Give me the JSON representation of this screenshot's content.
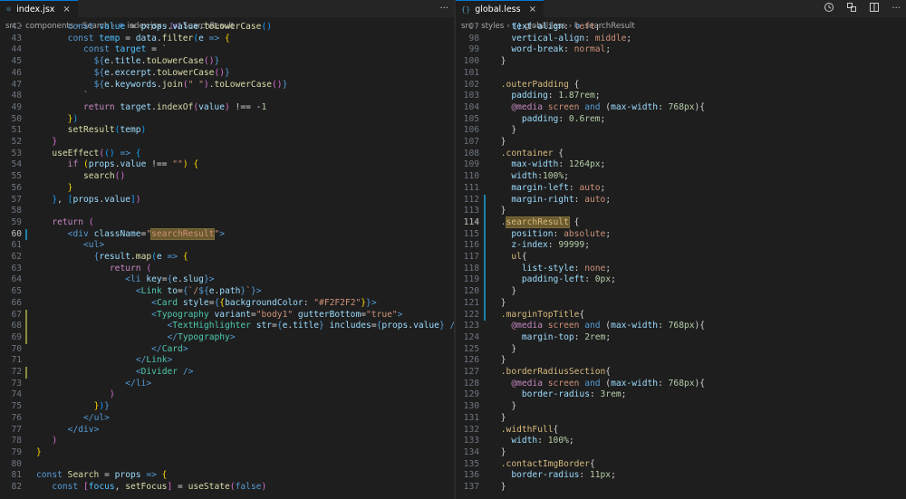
{
  "left": {
    "tab": {
      "icon": "react-file-icon",
      "label": "index.jsx",
      "close": "×"
    },
    "actions": "···",
    "breadcrumb": [
      "src",
      "components",
      "Search",
      "index.jsx",
      "SearchResult"
    ],
    "active_line": 60,
    "lines": [
      {
        "n": "42",
        "html": "<span class='b'>const</span> <span class='c'>value</span> = <span class='v'>props</span>.<span class='v'>value</span>.<span class='f'>toLowerCase</span><span class='br3'>()</span>",
        "indent": 6
      },
      {
        "n": "43",
        "html": "<span class='b'>const</span> <span class='c'>temp</span> = <span class='v'>data</span>.<span class='f'>filter</span><span class='br3'>(</span><span class='v'>e</span> <span class='b'>=&gt;</span> <span class='br1'>{</span>",
        "indent": 6
      },
      {
        "n": "44",
        "html": "<span class='b'>const</span> <span class='c'>target</span> = <span class='s'>`</span>",
        "indent": 9
      },
      {
        "n": "45",
        "html": "<span class='b'>${</span><span class='v'>e</span>.<span class='v'>title</span>.<span class='f'>toLowerCase</span><span class='br2'>()</span><span class='b'>}</span>",
        "indent": 11
      },
      {
        "n": "46",
        "html": "<span class='b'>${</span><span class='v'>e</span>.<span class='v'>excerpt</span>.<span class='f'>toLowerCase</span><span class='br2'>()</span><span class='b'>}</span>",
        "indent": 11
      },
      {
        "n": "47",
        "html": "<span class='b'>${</span><span class='v'>e</span>.<span class='v'>keywords</span>.<span class='f'>join</span><span class='br2'>(</span><span class='s'>\" \"</span><span class='br2'>)</span>.<span class='f'>toLowerCase</span><span class='br2'>()</span><span class='b'>}</span>",
        "indent": 11
      },
      {
        "n": "48",
        "html": "<span class='s'>`</span>",
        "indent": 9
      },
      {
        "n": "49",
        "html": "<span class='k'>return</span> <span class='v'>target</span>.<span class='f'>indexOf</span><span class='br2'>(</span><span class='v'>value</span><span class='br2'>)</span> !== -<span class='n'>1</span>",
        "indent": 9
      },
      {
        "n": "50",
        "html": "<span class='br1'>}</span><span class='br3'>)</span>",
        "indent": 6
      },
      {
        "n": "51",
        "html": "<span class='f'>setResult</span><span class='br3'>(</span><span class='v'>temp</span><span class='br3'>)</span>",
        "indent": 6
      },
      {
        "n": "52",
        "html": "<span class='br2'>}</span>",
        "indent": 3
      },
      {
        "n": "53",
        "html": "<span class='f'>useEffect</span><span class='br2'>(</span><span class='br3'>()</span> <span class='b'>=&gt;</span> <span class='br3'>{</span>",
        "indent": 3
      },
      {
        "n": "54",
        "html": "<span class='k'>if</span> <span class='br1'>(</span><span class='v'>props</span>.<span class='v'>value</span> !== <span class='s'>\"\"</span><span class='br1'>)</span> <span class='br1'>{</span>",
        "indent": 6
      },
      {
        "n": "55",
        "html": "<span class='f'>search</span><span class='br2'>()</span>",
        "indent": 9
      },
      {
        "n": "56",
        "html": "<span class='br1'>}</span>",
        "indent": 6
      },
      {
        "n": "57",
        "html": "<span class='br3'>}</span>, <span class='br3'>[</span><span class='v'>props</span>.<span class='v'>value</span><span class='br3'>]</span><span class='br2'>)</span>",
        "indent": 3
      },
      {
        "n": "58",
        "html": "",
        "indent": 0
      },
      {
        "n": "59",
        "html": "<span class='k'>return</span> <span class='br2'>(</span>",
        "indent": 3
      },
      {
        "n": "60",
        "html": "<span class='b'>&lt;</span><span class='b'>div</span> <span class='v'>className</span>=<span class='s'>\"<span class='hl'>searchResult</span>\"</span><span class='b'>&gt;</span>",
        "indent": 6
      },
      {
        "n": "61",
        "html": "<span class='b'>&lt;</span><span class='b'>ul</span><span class='b'>&gt;</span>",
        "indent": 9
      },
      {
        "n": "62",
        "html": "<span class='b'>{</span><span class='v'>result</span>.<span class='f'>map</span><span class='br3'>(</span><span class='v'>e</span> <span class='b'>=&gt;</span> <span class='br1'>{</span>",
        "indent": 11
      },
      {
        "n": "63",
        "html": "<span class='k'>return</span> <span class='br2'>(</span>",
        "indent": 14
      },
      {
        "n": "64",
        "html": "<span class='b'>&lt;</span><span class='b'>li</span> <span class='v'>key</span>=<span class='b'>{</span><span class='v'>e</span>.<span class='v'>slug</span><span class='b'>}</span><span class='b'>&gt;</span>",
        "indent": 17
      },
      {
        "n": "65",
        "html": "<span class='b'>&lt;</span><span class='t'>Link</span> <span class='v'>to</span>=<span class='b'>{</span><span class='s'>`/</span><span class='b'>${</span><span class='v'>e</span>.<span class='v'>path</span><span class='b'>}</span><span class='s'>`</span><span class='b'>}</span><span class='b'>&gt;</span>",
        "indent": 19
      },
      {
        "n": "66",
        "html": "<span class='b'>&lt;</span><span class='t'>Card</span> <span class='v'>style</span>=<span class='b'>{</span><span class='br1'>{</span><span class='v'>backgroundColor</span>: <span class='s'>\"#F2F2F2\"</span><span class='br1'>}</span><span class='b'>}</span><span class='b'>&gt;</span>",
        "indent": 22
      },
      {
        "n": "67",
        "html": "<span class='b'>&lt;</span><span class='t'>Typography</span> <span class='v'>variant</span>=<span class='s'>\"body1\"</span> <span class='v'>gutterBottom</span>=<span class='s'>\"true\"</span><span class='b'>&gt;</span>",
        "indent": 22
      },
      {
        "n": "68",
        "html": "<span class='b'>&lt;</span><span class='t'>TextHighlighter</span> <span class='v'>str</span>=<span class='b'>{</span><span class='v'>e</span>.<span class='v'>title</span><span class='b'>}</span> <span class='v'>includes</span>=<span class='b'>{</span><span class='v'>props</span>.<span class='v'>value</span><span class='b'>}</span> <span class='b'>/&gt;</span>",
        "indent": 25
      },
      {
        "n": "69",
        "html": "<span class='b'>&lt;/</span><span class='t'>Typography</span><span class='b'>&gt;</span>",
        "indent": 25
      },
      {
        "n": "70",
        "html": "<span class='b'>&lt;/</span><span class='t'>Card</span><span class='b'>&gt;</span>",
        "indent": 22
      },
      {
        "n": "71",
        "html": "<span class='b'>&lt;/</span><span class='t'>Link</span><span class='b'>&gt;</span>",
        "indent": 19
      },
      {
        "n": "72",
        "html": "<span class='b'>&lt;</span><span class='t'>Divider</span> <span class='b'>/&gt;</span>",
        "indent": 19
      },
      {
        "n": "73",
        "html": "<span class='b'>&lt;/</span><span class='b'>li</span><span class='b'>&gt;</span>",
        "indent": 17
      },
      {
        "n": "74",
        "html": "<span class='br2'>)</span>",
        "indent": 14
      },
      {
        "n": "75",
        "html": "<span class='br1'>}</span><span class='br3'>)</span><span class='b'>}</span>",
        "indent": 11
      },
      {
        "n": "76",
        "html": "<span class='b'>&lt;/</span><span class='b'>ul</span><span class='b'>&gt;</span>",
        "indent": 9
      },
      {
        "n": "77",
        "html": "<span class='b'>&lt;/</span><span class='b'>div</span><span class='b'>&gt;</span>",
        "indent": 6
      },
      {
        "n": "78",
        "html": "<span class='br2'>)</span>",
        "indent": 3
      },
      {
        "n": "79",
        "html": "<span class='br1'>}</span>",
        "indent": 0
      },
      {
        "n": "80",
        "html": "",
        "indent": 0
      },
      {
        "n": "81",
        "html": "<span class='b'>const</span> <span class='f'>Search</span> = <span class='v'>props</span> <span class='b'>=&gt;</span> <span class='br1'>{</span>",
        "indent": 0
      },
      {
        "n": "82",
        "html": "<span class='b'>const</span> <span class='br2'>[</span><span class='c'>focus</span>, <span class='f'>setFocus</span><span class='br2'>]</span> = <span class='f'>useState</span><span class='br2'>(</span><span class='b'>false</span><span class='br2'>)</span>",
        "indent": 3
      }
    ]
  },
  "right": {
    "tab": {
      "icon": "braces-icon",
      "label": "global.less",
      "close": "×"
    },
    "breadcrumb": [
      "src",
      "styles",
      "global.less",
      ".searchResult"
    ],
    "active_line": 114,
    "lines": [
      {
        "n": "97",
        "html": "<span class='pr'>text-align</span>: <span class='val'>left</span>;",
        "indent": 3
      },
      {
        "n": "98",
        "html": "<span class='pr'>vertical-align</span>: <span class='val'>middle</span>;",
        "indent": 3
      },
      {
        "n": "99",
        "html": "<span class='pr'>word-break</span>: <span class='val'>normal</span>;",
        "indent": 3
      },
      {
        "n": "100",
        "html": "}",
        "indent": 1
      },
      {
        "n": "101",
        "html": "",
        "indent": 0
      },
      {
        "n": "102",
        "html": "<span class='sel'>.outerPadding</span> {",
        "indent": 1
      },
      {
        "n": "103",
        "html": "<span class='pr'>padding</span>: <span class='num'>1.87rem</span>;",
        "indent": 3
      },
      {
        "n": "104",
        "html": "<span class='k'>@media</span> <span class='val'>screen</span> <span class='b'>and</span> (<span class='pr'>max-width</span>: <span class='num'>768px</span>){",
        "indent": 3
      },
      {
        "n": "105",
        "html": "<span class='pr'>padding</span>: <span class='num'>0.6rem</span>;",
        "indent": 5
      },
      {
        "n": "106",
        "html": "}",
        "indent": 3
      },
      {
        "n": "107",
        "html": "}",
        "indent": 1
      },
      {
        "n": "108",
        "html": "<span class='sel'>.container</span> {",
        "indent": 1
      },
      {
        "n": "109",
        "html": "<span class='pr'>max-width</span>: <span class='num'>1264px</span>;",
        "indent": 3
      },
      {
        "n": "110",
        "html": "<span class='pr'>width</span>:<span class='num'>100%</span>;",
        "indent": 3
      },
      {
        "n": "111",
        "html": "<span class='pr'>margin-left</span>: <span class='val'>auto</span>;",
        "indent": 3
      },
      {
        "n": "112",
        "html": "<span class='pr'>margin-right</span>: <span class='val'>auto</span>;",
        "indent": 3
      },
      {
        "n": "113",
        "html": "}",
        "indent": 1
      },
      {
        "n": "114",
        "html": "<span class='sel'>.<span class='hl'>searchResult</span></span> {",
        "indent": 1
      },
      {
        "n": "115",
        "html": "<span class='pr'>position</span>: <span class='val'>absolute</span>;",
        "indent": 3
      },
      {
        "n": "116",
        "html": "<span class='pr'>z-index</span>: <span class='num'>99999</span>;",
        "indent": 3
      },
      {
        "n": "117",
        "html": "<span class='sel'>ul</span>{",
        "indent": 3
      },
      {
        "n": "118",
        "html": "<span class='pr'>list-style</span>: <span class='val'>none</span>;",
        "indent": 5
      },
      {
        "n": "119",
        "html": "<span class='pr'>padding-left</span>: <span class='num'>0px</span>;",
        "indent": 5
      },
      {
        "n": "120",
        "html": "}",
        "indent": 3
      },
      {
        "n": "121",
        "html": "}",
        "indent": 1
      },
      {
        "n": "122",
        "html": "<span class='sel'>.marginTopTitle</span>{",
        "indent": 1
      },
      {
        "n": "123",
        "html": "<span class='k'>@media</span> <span class='val'>screen</span> <span class='b'>and</span> (<span class='pr'>max-width</span>: <span class='num'>768px</span>){",
        "indent": 3
      },
      {
        "n": "124",
        "html": "<span class='pr'>margin-top</span>: <span class='num'>2rem</span>;",
        "indent": 5
      },
      {
        "n": "125",
        "html": "}",
        "indent": 3
      },
      {
        "n": "126",
        "html": "}",
        "indent": 1
      },
      {
        "n": "127",
        "html": "<span class='sel'>.borderRadiusSection</span>{",
        "indent": 1
      },
      {
        "n": "128",
        "html": "<span class='k'>@media</span> <span class='val'>screen</span> <span class='b'>and</span> (<span class='pr'>max-width</span>: <span class='num'>768px</span>){",
        "indent": 3
      },
      {
        "n": "129",
        "html": "<span class='pr'>border-radius</span>: <span class='num'>3rem</span>;",
        "indent": 5
      },
      {
        "n": "130",
        "html": "}",
        "indent": 3
      },
      {
        "n": "131",
        "html": "}",
        "indent": 1
      },
      {
        "n": "132",
        "html": "<span class='sel'>.widthFull</span>{",
        "indent": 1
      },
      {
        "n": "133",
        "html": "<span class='pr'>width</span>: <span class='num'>100%</span>;",
        "indent": 3
      },
      {
        "n": "134",
        "html": "}",
        "indent": 1
      },
      {
        "n": "135",
        "html": "<span class='sel'>.contactImgBorder</span>{",
        "indent": 1
      },
      {
        "n": "136",
        "html": "<span class='pr'>border-radius</span>: <span class='num'>11px</span>;",
        "indent": 3
      },
      {
        "n": "137",
        "html": "}",
        "indent": 1
      }
    ]
  },
  "icons": {
    "timeline": "timeline-icon",
    "compare": "compare-changes-icon",
    "split": "split-editor-icon",
    "more": "more-actions-icon"
  }
}
